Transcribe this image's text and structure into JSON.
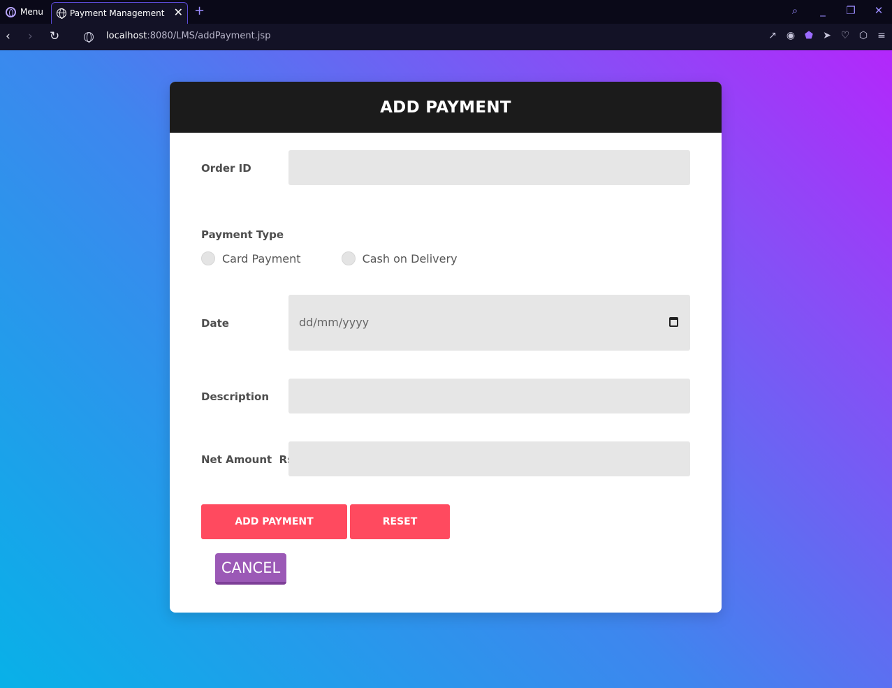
{
  "browser": {
    "menu_label": "Menu",
    "tab_title": "Payment Management",
    "tab_close": "✕",
    "new_tab": "+",
    "url_host": "localhost",
    "url_rest": ":8080/LMS/addPayment.jsp"
  },
  "form": {
    "title": "ADD PAYMENT",
    "order_id_label": "Order ID",
    "payment_type_label": "Payment Type",
    "payment_options": [
      "Card Payment",
      "Cash on Delivery"
    ],
    "date_label": "Date",
    "date_placeholder": "dd/mm/yyyy",
    "description_label": "Description",
    "net_amount_label": "Net Amount  Rs.",
    "add_button": "ADD PAYMENT",
    "reset_button": "RESET",
    "cancel_button": "CANCEL"
  },
  "colors": {
    "accent_red": "#ff4a5f",
    "cancel_purple": "#9b59b6",
    "header_dark": "#1b1b1b"
  }
}
